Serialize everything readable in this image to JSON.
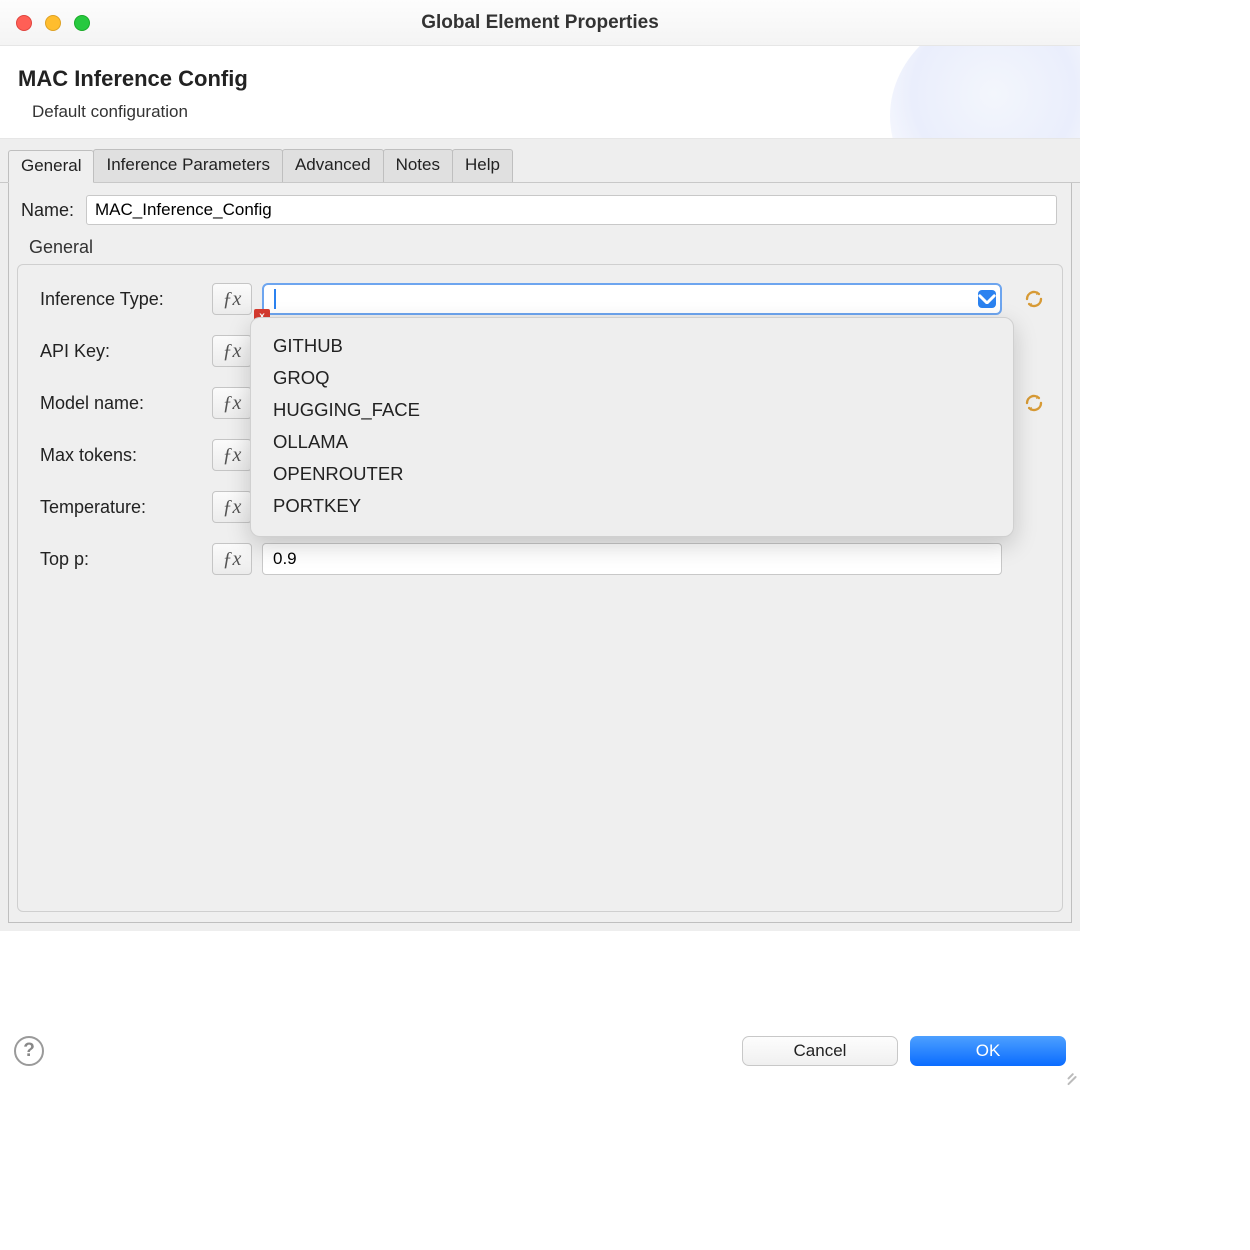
{
  "window": {
    "title": "Global Element Properties"
  },
  "header": {
    "title": "MAC Inference Config",
    "subtitle": "Default configuration"
  },
  "tabs": [
    {
      "label": "General"
    },
    {
      "label": "Inference Parameters"
    },
    {
      "label": "Advanced"
    },
    {
      "label": "Notes"
    },
    {
      "label": "Help"
    }
  ],
  "activeTab": 0,
  "name": {
    "label": "Name:",
    "value": "MAC_Inference_Config"
  },
  "group": {
    "label": "General"
  },
  "form": {
    "inferenceType": {
      "label": "Inference Type:",
      "value": "",
      "error": "x"
    },
    "apiKey": {
      "label": "API Key:",
      "value": ""
    },
    "modelName": {
      "label": "Model name:",
      "value": ""
    },
    "maxTokens": {
      "label": "Max tokens:",
      "value": ""
    },
    "temperature": {
      "label": "Temperature:",
      "value": ""
    },
    "topP": {
      "label": "Top p:",
      "value": "0.9"
    }
  },
  "dropdown": {
    "options": [
      "GITHUB",
      "GROQ",
      "HUGGING_FACE",
      "OLLAMA",
      "OPENROUTER",
      "PORTKEY"
    ]
  },
  "buttons": {
    "cancel": "Cancel",
    "ok": "OK",
    "help": "?"
  }
}
